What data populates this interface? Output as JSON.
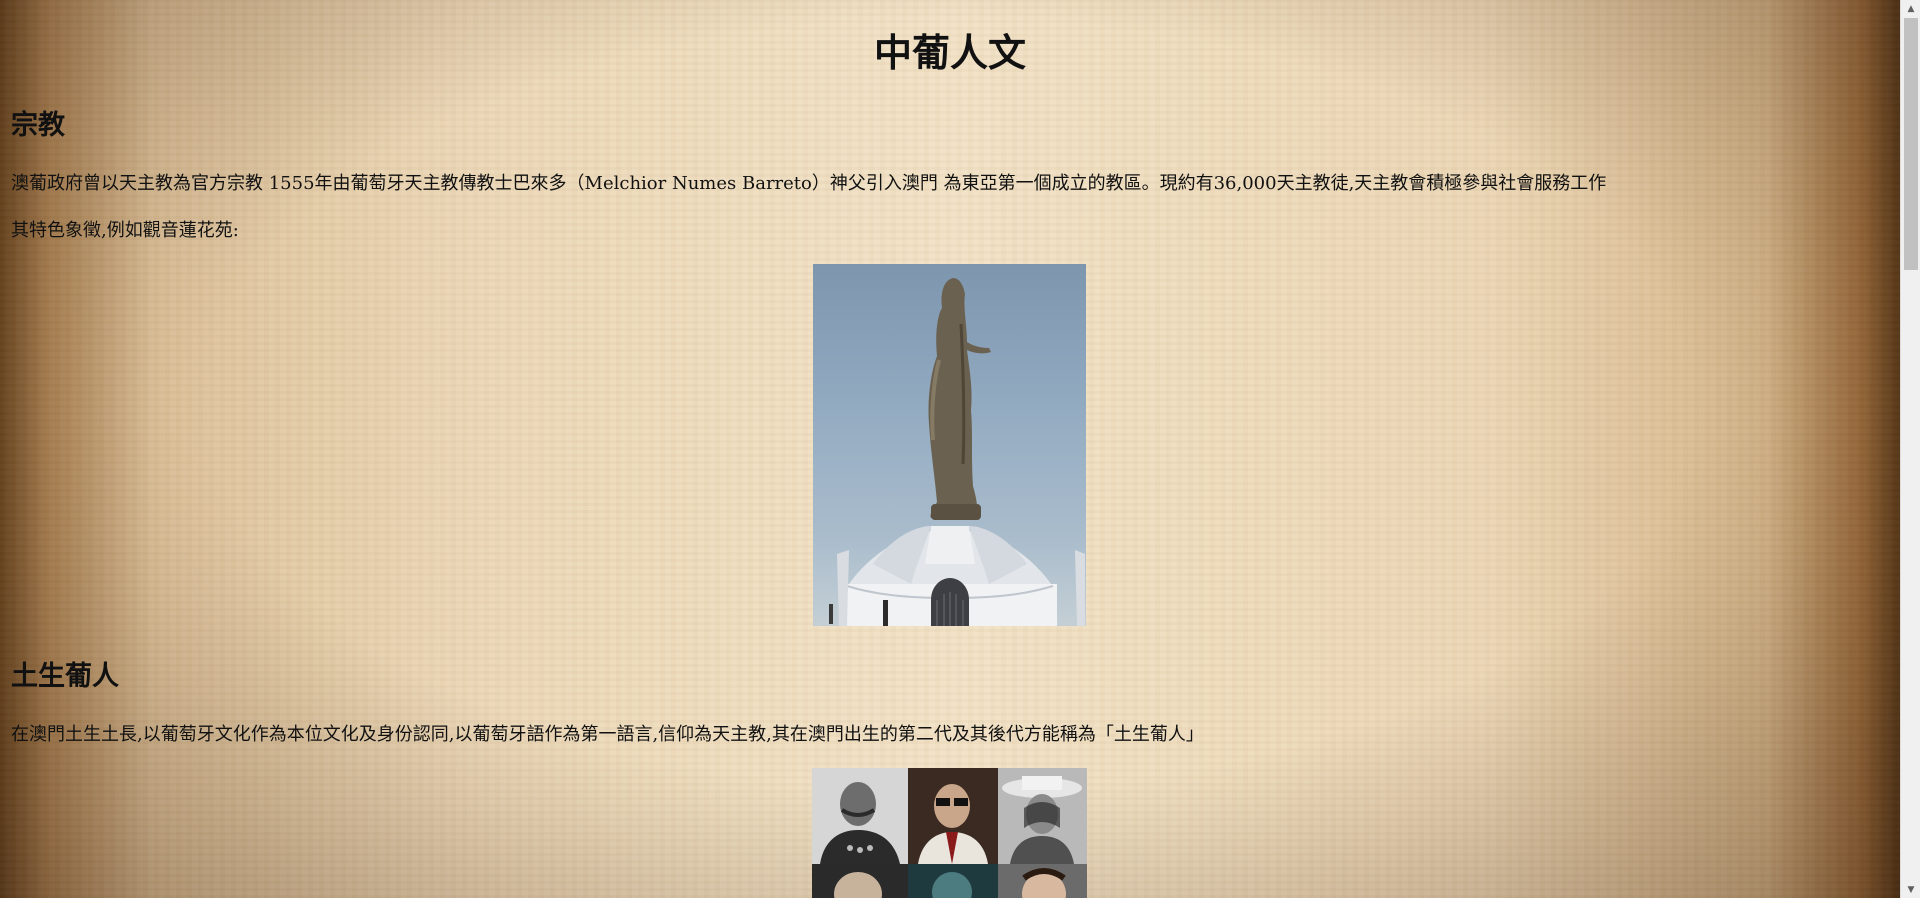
{
  "page": {
    "title": "中葡人文"
  },
  "sections": [
    {
      "heading": "宗教",
      "paragraphs": [
        "澳葡政府曾以天主教為官方宗教 1555年由葡萄牙天主教傳教士巴來多（Melchior Numes Barreto）神父引入澳門 為東亞第一個成立的教區。現約有36,000天主教徒,天主教會積極參與社會服務工作",
        "其特色象徵,例如觀音蓮花苑:"
      ],
      "image_icon": "kun-iam-statue-photo"
    },
    {
      "heading": "土生葡人",
      "paragraphs": [
        "在澳門土生土長,以葡萄牙文化作為本位文化及身份認同,以葡萄牙語作為第一語言,信仰為天主教,其在澳門出生的第二代及其後代方能稱為「土生葡人」"
      ],
      "image_icon": "macanese-portraits-collage"
    }
  ],
  "scrollbar": {
    "up_icon": "scroll-up-arrow-icon",
    "down_icon": "scroll-down-arrow-icon",
    "position_fraction": 0.0
  }
}
